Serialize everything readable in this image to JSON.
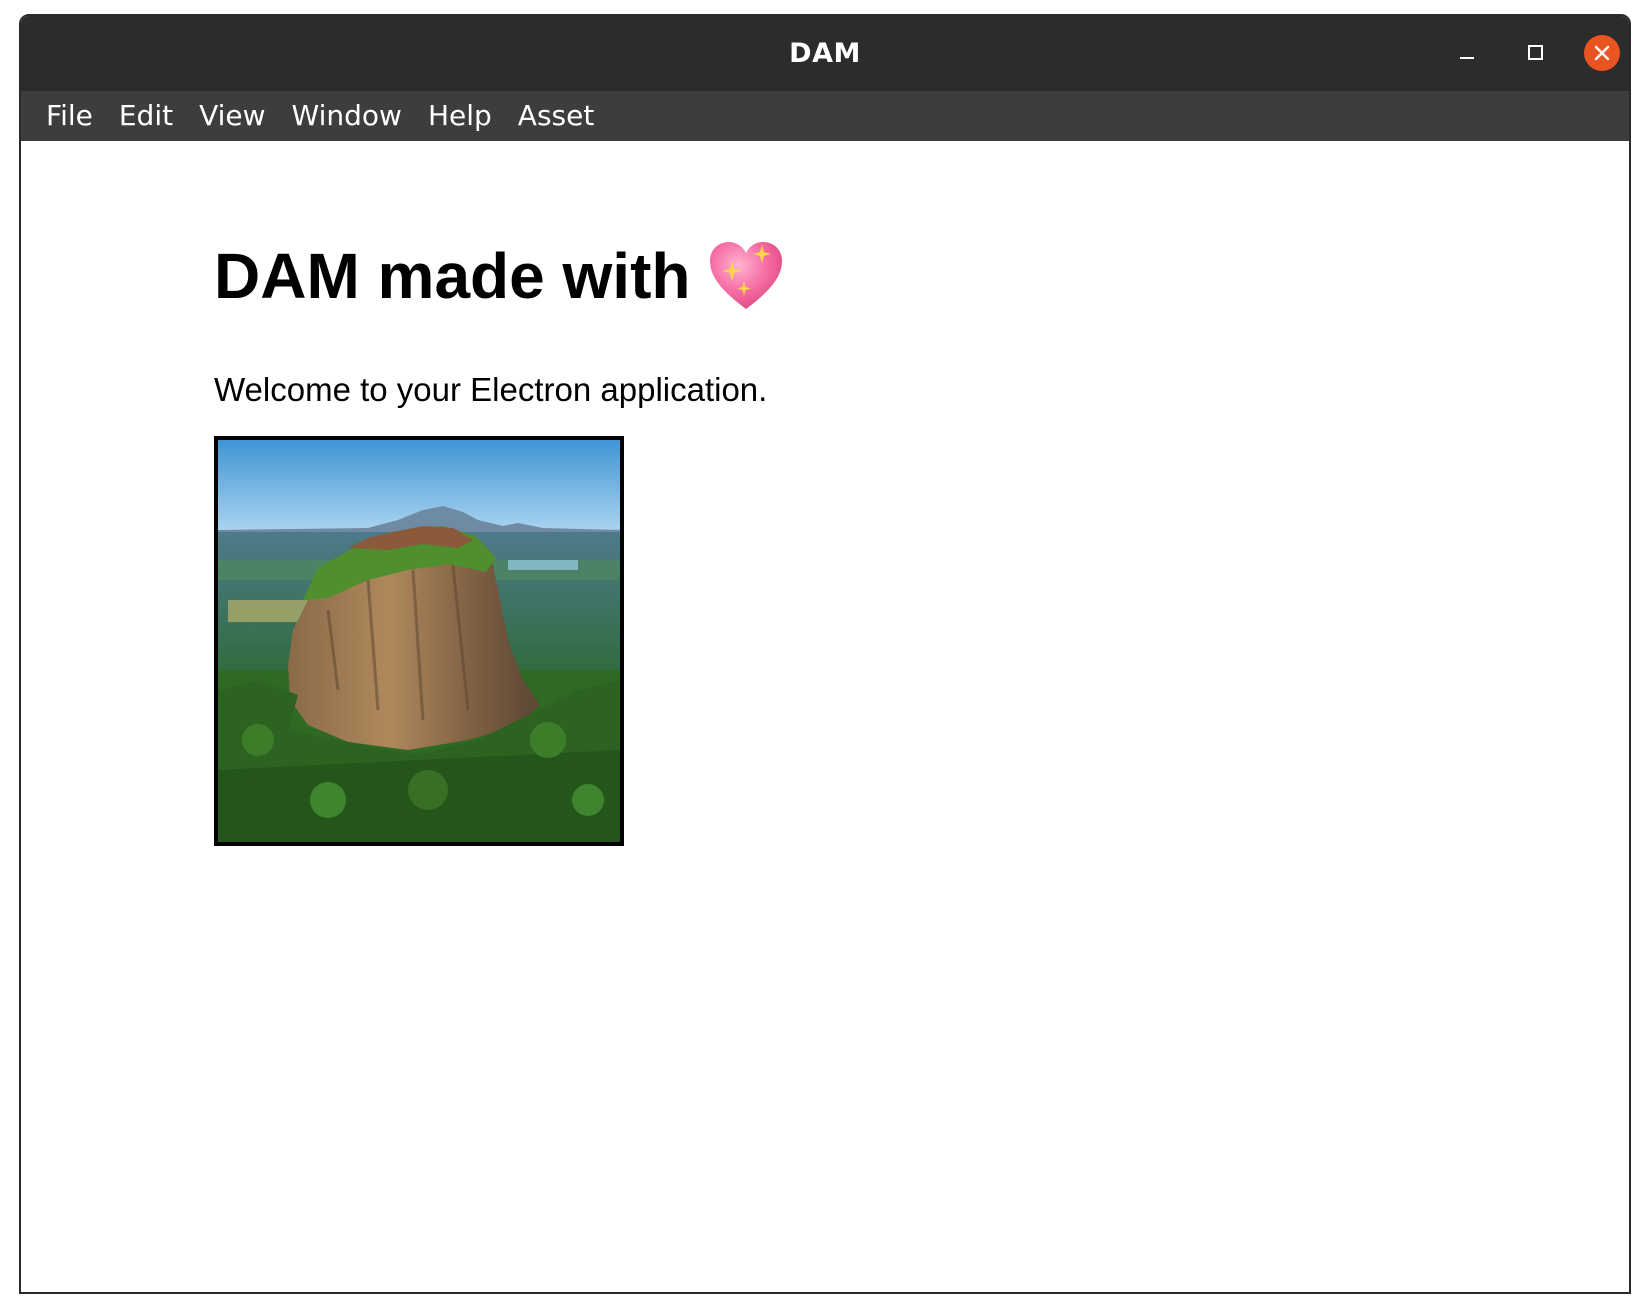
{
  "window": {
    "title": "DAM",
    "controls": [
      "minimize-icon",
      "maximize-icon",
      "close-icon"
    ],
    "close_color": "#e95420",
    "titlebar_color": "#2c2c2c",
    "menubar_color": "#3d3d3d"
  },
  "menu": {
    "items": [
      "File",
      "Edit",
      "View",
      "Window",
      "Help",
      "Asset"
    ]
  },
  "main": {
    "heading": "DAM made with",
    "heading_emoji": "sparkling-heart-icon",
    "welcome": "Welcome to your Electron application.",
    "image": {
      "subject": "sigiriya-rock-photo",
      "border_color": "#000000"
    }
  }
}
